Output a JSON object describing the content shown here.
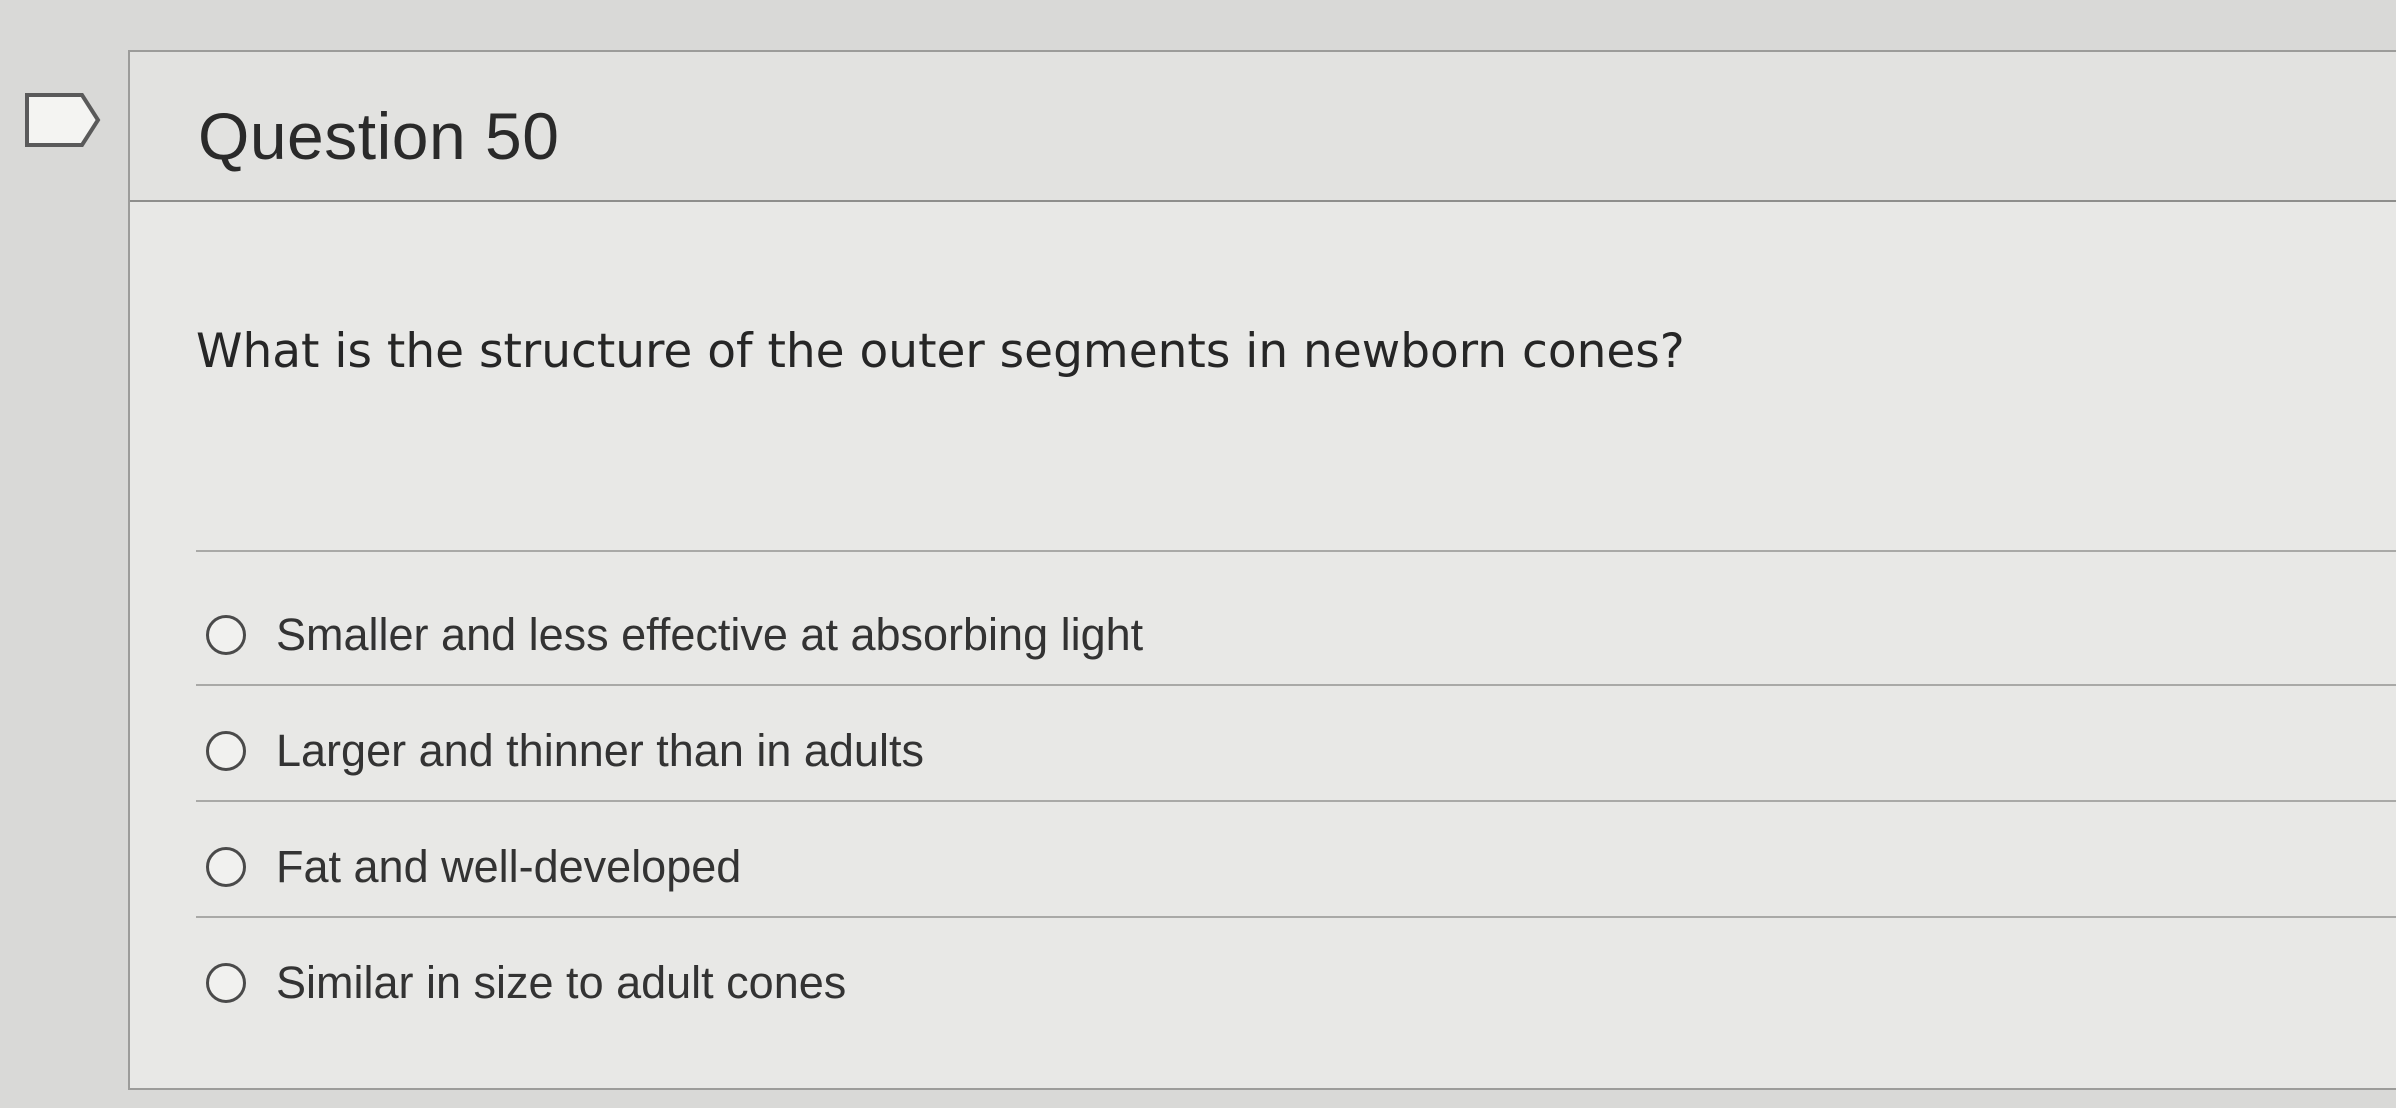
{
  "question": {
    "title": "Question 50",
    "text": "What is the structure of the outer segments in newborn cones?",
    "flag_icon": "flag-outline-icon"
  },
  "answers": [
    {
      "label": "Smaller and less effective at absorbing light",
      "selected": false
    },
    {
      "label": "Larger and thinner than in adults",
      "selected": false
    },
    {
      "label": "Fat and well-developed",
      "selected": false
    },
    {
      "label": "Similar in size to adult cones",
      "selected": false
    }
  ]
}
